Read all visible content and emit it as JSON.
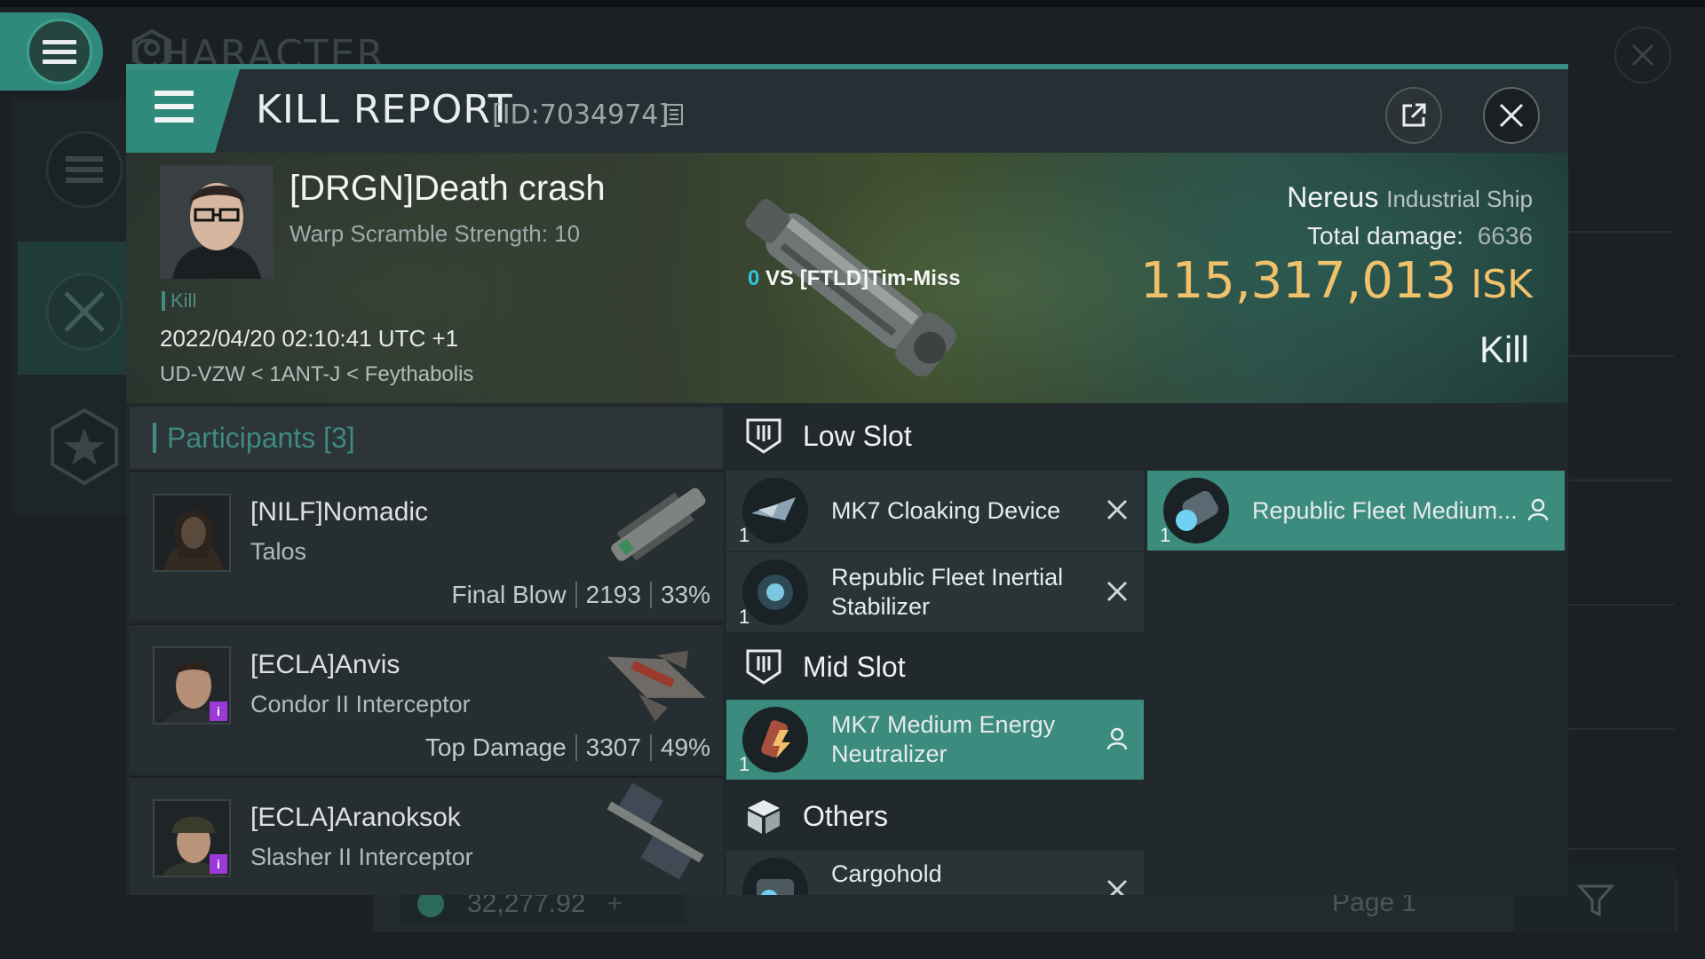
{
  "background": {
    "title": "CHARACTER",
    "wallet_value": "32,277.92",
    "page_label": "Page 1"
  },
  "modal": {
    "title": "KILL REPORT",
    "report_id": "[ID:7034974]"
  },
  "victim": {
    "name": "[DRGN]Death crash",
    "warp_scramble": "Warp Scramble Strength: 10",
    "kill_tag": "Kill",
    "datetime": "2022/04/20 02:10:41 UTC +1",
    "location": "UD-VZW < 1ANT-J < Feythabolis",
    "vs_count": "0",
    "vs_text": "VS [FTLD]Tim-Miss"
  },
  "ship": {
    "name": "Nereus",
    "class": "Industrial Ship",
    "total_damage_label": "Total damage:",
    "total_damage": "6636",
    "isk_value": "115,317,013",
    "isk_unit": "ISK",
    "result": "Kill"
  },
  "participants": {
    "title": "Participants [3]",
    "list": [
      {
        "name": "[NILF]Nomadic",
        "ship": "Talos",
        "role": "Final Blow",
        "damage": "2193",
        "percent": "33%"
      },
      {
        "name": "[ECLA]Anvis",
        "ship": "Condor II Interceptor",
        "role": "Top Damage",
        "damage": "3307",
        "percent": "49%"
      },
      {
        "name": "[ECLA]Aranoksok",
        "ship": "Slasher II Interceptor",
        "role": "",
        "damage": "",
        "percent": ""
      }
    ]
  },
  "fitting": {
    "low_slot_title": "Low Slot",
    "mid_slot_title": "Mid Slot",
    "others_title": "Others",
    "low": [
      {
        "name": "MK7 Cloaking Device",
        "qty": "1",
        "status": "destroyed"
      },
      {
        "name": "Republic Fleet Inertial Stabilizer",
        "qty": "1",
        "status": "destroyed"
      }
    ],
    "low_dropped": {
      "name": "Republic Fleet Medium...",
      "qty": "1",
      "status": "dropped"
    },
    "mid": [
      {
        "name": "MK7 Medium Energy Neutralizer",
        "qty": "1",
        "status": "dropped"
      }
    ],
    "others": [
      {
        "name": "Cargohold",
        "qty": "",
        "status": "destroyed"
      }
    ]
  },
  "colors": {
    "accent": "#3a8f82",
    "isk": "#f0c06a",
    "vs_count": "#2fc4e0",
    "badge": "#9b3ad8"
  }
}
